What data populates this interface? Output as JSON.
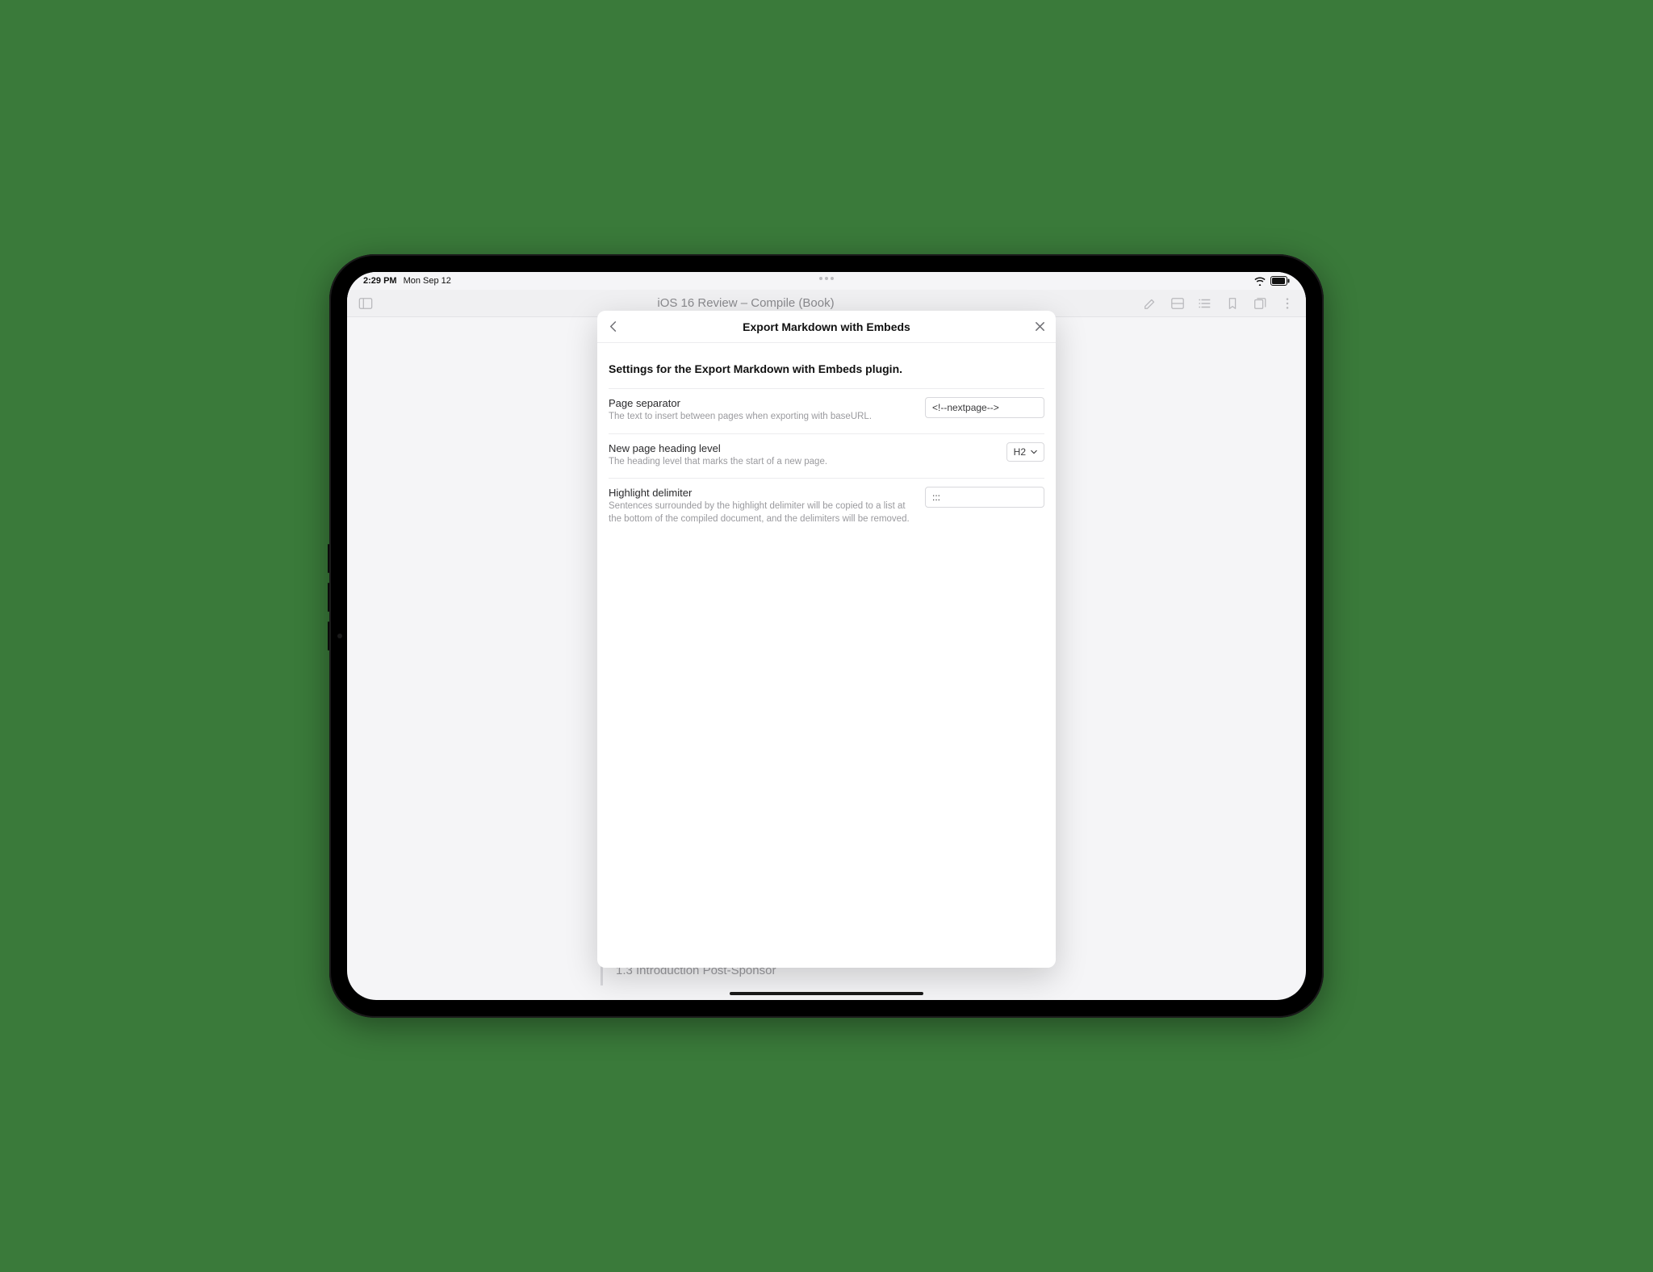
{
  "status": {
    "time": "2:29 PM",
    "date": "Mon Sep 12"
  },
  "app": {
    "title": "iOS 16 Review – Compile (Book)"
  },
  "sheet": {
    "title": "Export Markdown with Embeds",
    "description": "Settings for the Export Markdown with Embeds plugin.",
    "rows": {
      "pageSeparator": {
        "label": "Page separator",
        "sub": "The text to insert between pages when exporting with baseURL.",
        "value": "<!--nextpage-->"
      },
      "headingLevel": {
        "label": "New page heading level",
        "sub": "The heading level that marks the start of a new page.",
        "value": "H2"
      },
      "highlightDelimiter": {
        "label": "Highlight delimiter",
        "sub": "Sentences surrounded by the highlight delimiter will be copied to a list at the bottom of the compiled document, and the delimiters will be removed.",
        "value": ":::"
      }
    }
  },
  "background": {
    "sectionTitle": "1.3 Introduction Post-Sponsor"
  }
}
